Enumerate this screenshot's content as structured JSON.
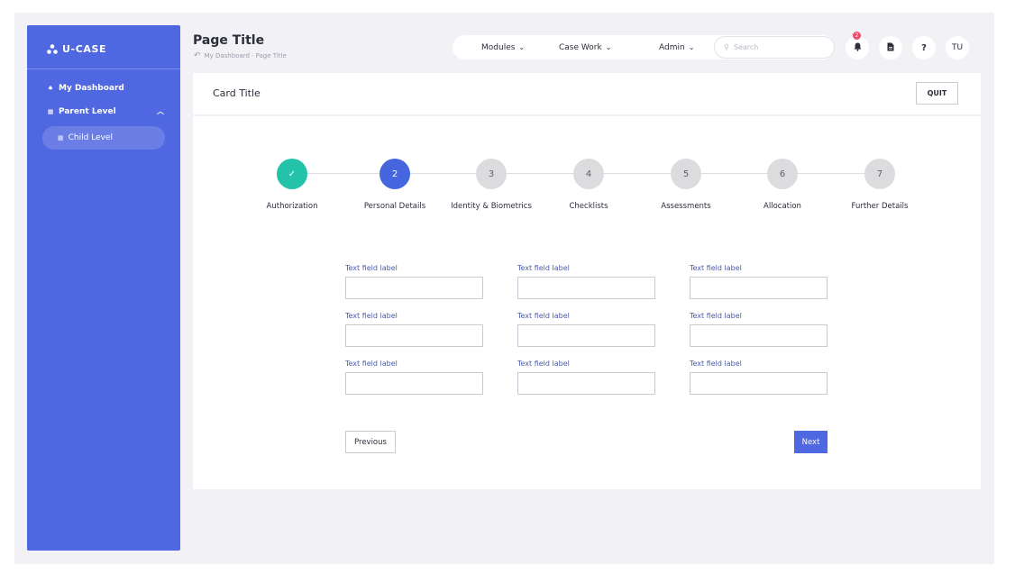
{
  "app": {
    "logo_text": "U-CASE"
  },
  "sidebar": {
    "dashboard_label": "My Dashboard",
    "parent_label": "Parent Level",
    "child_label": "Child Level"
  },
  "header": {
    "page_title": "Page Title",
    "breadcrumb": "My Dashboard · Page Title",
    "nav": {
      "modules": "Modules",
      "case_work": "Case Work",
      "admin": "Admin"
    },
    "search_placeholder": "Search",
    "notification_count": "2",
    "help_label": "?",
    "user_initials": "TU"
  },
  "card": {
    "title": "Card Title",
    "quit_label": "QUIT"
  },
  "stepper": {
    "steps": [
      {
        "number": "✓",
        "label": "Authorization",
        "state": "done"
      },
      {
        "number": "2",
        "label": "Personal Details",
        "state": "active"
      },
      {
        "number": "3",
        "label": "Identity & Biometrics",
        "state": "todo"
      },
      {
        "number": "4",
        "label": "Checklists",
        "state": "todo"
      },
      {
        "number": "5",
        "label": "Assessments",
        "state": "todo"
      },
      {
        "number": "6",
        "label": "Allocation",
        "state": "todo"
      },
      {
        "number": "7",
        "label": "Further Details",
        "state": "todo"
      }
    ]
  },
  "form": {
    "fields": [
      {
        "label": "Text field label",
        "value": ""
      },
      {
        "label": "Text field label",
        "value": ""
      },
      {
        "label": "Text field label",
        "value": ""
      },
      {
        "label": "Text field label",
        "value": ""
      },
      {
        "label": "Text field label",
        "value": ""
      },
      {
        "label": "Text field label",
        "value": ""
      },
      {
        "label": "Text field label",
        "value": ""
      },
      {
        "label": "Text field label",
        "value": ""
      },
      {
        "label": "Text field label",
        "value": ""
      }
    ],
    "previous_label": "Previous",
    "next_label": "Next"
  },
  "colors": {
    "primary": "#4f67e0",
    "step_done": "#22c3a9",
    "step_active": "#4666e0",
    "badge": "#ee4d6a"
  }
}
